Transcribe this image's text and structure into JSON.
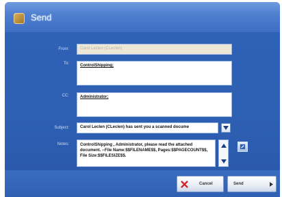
{
  "window": {
    "title": "Send"
  },
  "form": {
    "from": {
      "label": "From:",
      "value": "Carol Leclen (CLeclen)"
    },
    "to": {
      "label": "To:",
      "value": "ControlShipping;"
    },
    "cc": {
      "label": "CC:",
      "value": "Administrator;"
    },
    "subject": {
      "label": "Subject:",
      "value": "Carol Leclen (CLeclen) has sent you a scanned docume"
    },
    "notes": {
      "label": "Notes:",
      "value": "ControlShipping , Administrator, please read the attached document. --File Name:$$FILENAME$$, Pages:$$PAGECOUNT$$, File Size:$$FILESIZE$$."
    }
  },
  "buttons": {
    "cancel": "Cancel",
    "send": "Send"
  },
  "colors": {
    "window_bg": "#2d5fb3",
    "title_bar": "#4f7fcf",
    "cancel_x": "#d0232a"
  }
}
